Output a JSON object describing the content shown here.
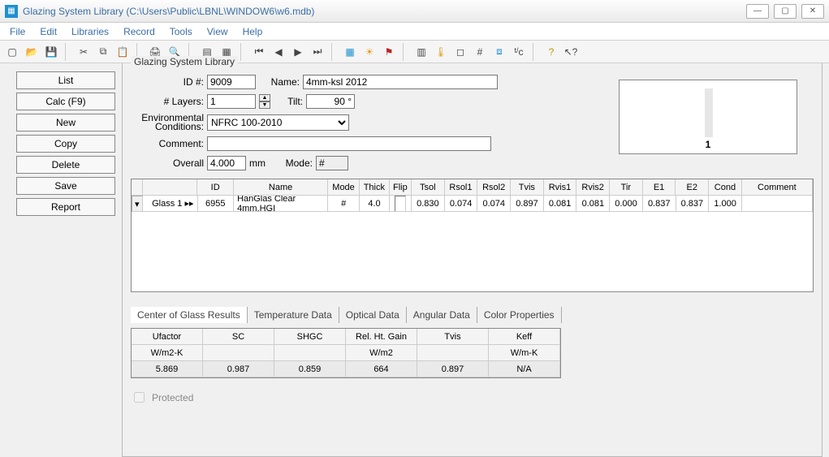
{
  "window": {
    "title": "Glazing System Library (C:\\Users\\Public\\LBNL\\WINDOW6\\w6.mdb)"
  },
  "menu": {
    "items": [
      "File",
      "Edit",
      "Libraries",
      "Record",
      "Tools",
      "View",
      "Help"
    ]
  },
  "sidebar": {
    "list": "List",
    "calc": "Calc (F9)",
    "new": "New",
    "copy": "Copy",
    "delete": "Delete",
    "save": "Save",
    "report": "Report"
  },
  "group": {
    "title": "Glazing System Library"
  },
  "form": {
    "id_label": "ID #:",
    "id_value": "9009",
    "name_label": "Name:",
    "name_value": "4mm-ksl 2012",
    "layers_label": "# Layers:",
    "layers_value": "1",
    "tilt_label": "Tilt:",
    "tilt_value": "90 °",
    "env_label": "Environmental\nConditions:",
    "env_value": "NFRC 100-2010",
    "comment_label": "Comment:",
    "comment_value": "",
    "overall_label": "Overall",
    "overall_value": "4.000",
    "overall_unit": "mm",
    "mode_label": "Mode:",
    "mode_value": "#"
  },
  "preview": {
    "layer_number": "1"
  },
  "grid": {
    "headers": [
      "",
      "",
      "ID",
      "Name",
      "Mode",
      "Thick",
      "Flip",
      "Tsol",
      "Rsol1",
      "Rsol2",
      "Tvis",
      "Rvis1",
      "Rvis2",
      "Tir",
      "E1",
      "E2",
      "Cond",
      "Comment"
    ],
    "widths": [
      14,
      70,
      46,
      120,
      40,
      38,
      28,
      42,
      42,
      42,
      42,
      42,
      42,
      42,
      42,
      42,
      42,
      90
    ],
    "row": {
      "label": "Glass 1 ▸▸",
      "id": "6955",
      "name": "HanGlas Clear 4mm.HGI",
      "mode": "#",
      "thick": "4.0",
      "tsol": "0.830",
      "rsol1": "0.074",
      "rsol2": "0.074",
      "tvis": "0.897",
      "rvis1": "0.081",
      "rvis2": "0.081",
      "tir": "0.000",
      "e1": "0.837",
      "e2": "0.837",
      "cond": "1.000",
      "comment": ""
    }
  },
  "tabs": [
    "Center of Glass Results",
    "Temperature Data",
    "Optical Data",
    "Angular Data",
    "Color Properties"
  ],
  "results": {
    "headers": [
      "Ufactor",
      "SC",
      "SHGC",
      "Rel. Ht. Gain",
      "Tvis",
      "Keff"
    ],
    "units": [
      "W/m2-K",
      "",
      "",
      "W/m2",
      "",
      "W/m-K"
    ],
    "values": [
      "5.869",
      "0.987",
      "0.859",
      "664",
      "0.897",
      "N/A"
    ]
  },
  "protected_label": "Protected"
}
